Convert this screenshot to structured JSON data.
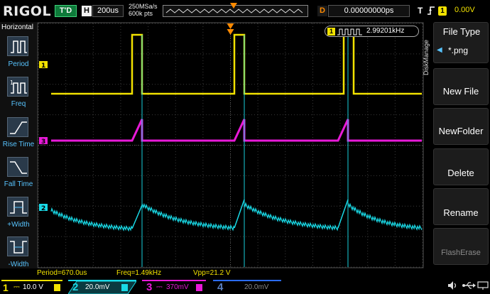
{
  "header": {
    "brand": "RIGOL",
    "trigger_status": "T'D",
    "horizontal_badge": "H",
    "timebase": "200us",
    "sample_rate": "250MSa/s",
    "memory_depth": "600k pts",
    "delay_badge": "D",
    "delay_value": "0.00000000ps",
    "trigger_badge": "T",
    "trigger_source": "1",
    "trigger_level": "0.00V"
  },
  "left_menu": {
    "title": "Horizontal",
    "items": [
      {
        "label": "Period",
        "icon": "period-pulse-icon"
      },
      {
        "label": "Freq",
        "icon": "frequency-pulse-icon"
      },
      {
        "label": "Rise Time",
        "icon": "rise-edge-icon"
      },
      {
        "label": "Fall Time",
        "icon": "fall-edge-icon"
      },
      {
        "label": "+Width",
        "icon": "positive-width-icon"
      },
      {
        "label": "-Width",
        "icon": "negative-width-icon"
      }
    ]
  },
  "right_menu": {
    "side_label": "DiskManage",
    "title": "File Type",
    "file_type": "*.png",
    "buttons": [
      "New File",
      "NewFolder",
      "Delete",
      "Rename",
      "FlashErase"
    ]
  },
  "freq_counter": {
    "channel": "1",
    "value": "2.99201kHz"
  },
  "channel_markers": {
    "ch1": "1",
    "ch3": "3",
    "ch2": "2"
  },
  "measurements": {
    "period": "Period=670.0us",
    "freq": "Freq=1.49kHz",
    "vpp": "Vpp=21.2 V"
  },
  "channels": [
    {
      "number": "1",
      "scale": "10.0 V",
      "color": "#f2e200"
    },
    {
      "number": "2",
      "scale": "20.0mV",
      "color": "#19d9e6"
    },
    {
      "number": "3",
      "scale": "370mV",
      "color": "#e81ad8"
    },
    {
      "number": "4",
      "scale": "20.0mV",
      "color": "#2a6cff"
    }
  ],
  "colors": {
    "ch1": "#f2e200",
    "ch2": "#19d9e6",
    "ch3": "#e81ad8",
    "trigger": "#ff8a00",
    "menu_label": "#58c4ff"
  }
}
